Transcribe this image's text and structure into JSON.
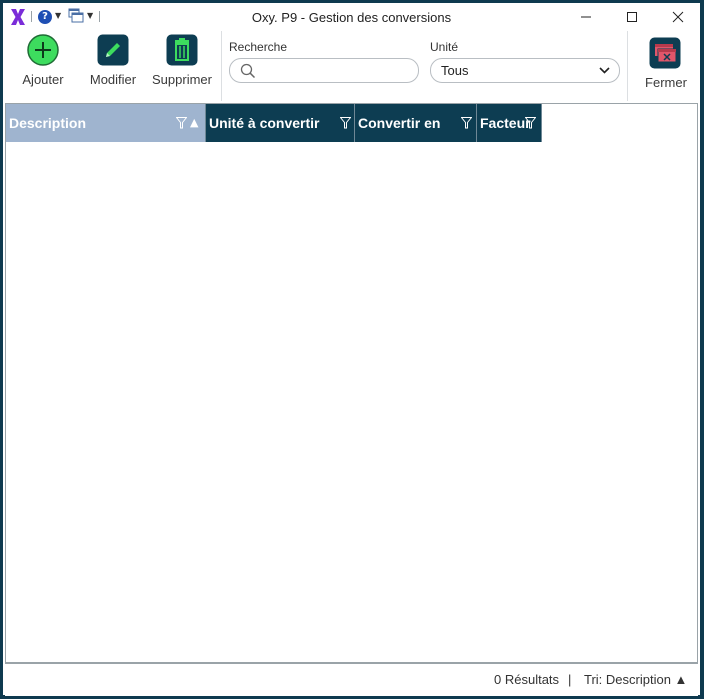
{
  "titlebar": {
    "title": "Oxy. P9 - Gestion des conversions",
    "help_icon": "question-circle-icon",
    "windows_icon": "windows-stack-icon",
    "minimize": "—",
    "maximize": "☐",
    "close": "✕"
  },
  "toolbar": {
    "add_label": "Ajouter",
    "edit_label": "Modifier",
    "delete_label": "Supprimer",
    "close_label": "Fermer",
    "search_label": "Recherche",
    "search_value": "",
    "search_placeholder": "",
    "unit_label": "Unité",
    "unit_value": "Tous"
  },
  "grid": {
    "columns": [
      {
        "label": "Description",
        "sorted": "asc"
      },
      {
        "label": "Unité à convertir"
      },
      {
        "label": "Convertir en"
      },
      {
        "label": "Facteur"
      }
    ],
    "rows": []
  },
  "status": {
    "results": "0 Résultats",
    "separator": "|",
    "sort": "Tri: Description ▲"
  },
  "colors": {
    "header_bg": "#0d3d52",
    "active_header_bg": "#9fb4cf",
    "add_green": "#3ddc5e",
    "logo_purple": "#7a2cd8",
    "close_red": "#e0566a"
  }
}
